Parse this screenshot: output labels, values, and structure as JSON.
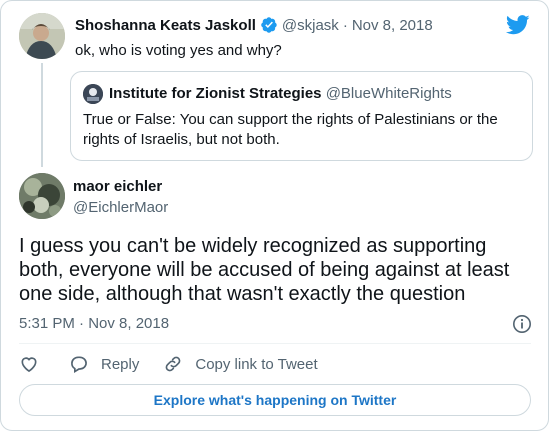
{
  "parent_tweet": {
    "name": "Shoshanna Keats Jaskoll",
    "handle": "@skjask",
    "separator": "·",
    "date": "Nov 8, 2018",
    "text": "ok, who is voting yes and why?",
    "verified": true
  },
  "quoted_tweet": {
    "name": "Institute for Zionist Strategies",
    "handle": "@BlueWhiteRights",
    "text": "True or False: You can support the rights of Palestinians or the rights of Israelis, but not both."
  },
  "main_tweet": {
    "name": "maor eichler",
    "handle": "@EichlerMaor",
    "text": "I guess you can't be widely recognized as supporting both, everyone will be accused of being against at least one side, although that wasn't exactly the question",
    "timestamp": "5:31 PM · Nov 8, 2018"
  },
  "actions": {
    "reply_label": "Reply",
    "copy_link_label": "Copy link to Tweet"
  },
  "explore_label": "Explore what's happening on Twitter",
  "colors": {
    "twitter_blue": "#1d9bf0",
    "link_blue": "#1d76c6",
    "muted": "#536471",
    "border": "#cfd9de"
  },
  "icons": [
    "twitter-logo-icon",
    "verified-badge-icon",
    "info-icon",
    "heart-icon",
    "reply-icon",
    "link-icon"
  ]
}
